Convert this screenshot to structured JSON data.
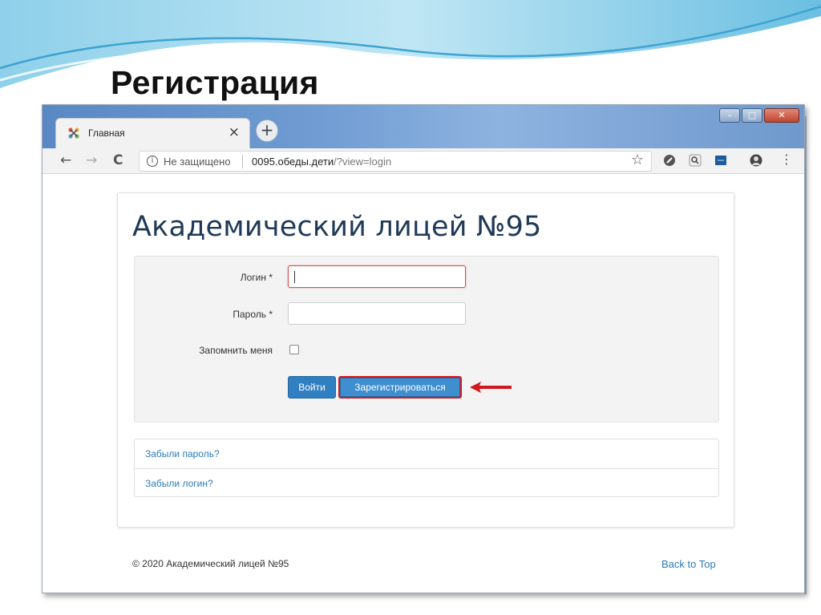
{
  "slide": {
    "title": "Регистрация"
  },
  "browser": {
    "tab_title": "Главная",
    "tab_close": "×",
    "new_tab": "+",
    "nav_back": "←",
    "nav_forward": "→",
    "nav_reload": "C",
    "security_label": "Не защищено",
    "url_domain": "0095.обеды.дети",
    "url_path": "/?view=login",
    "bookmark_star": "☆",
    "menu_dots": "⋮",
    "window_minimize": "–",
    "window_maximize": "□",
    "window_close": "✕"
  },
  "page": {
    "site_title": "Академический лицей №95",
    "form": {
      "login_label": "Логин *",
      "login_value": "",
      "password_label": "Пароль *",
      "password_value": "",
      "remember_label": "Запомнить меня",
      "remember_checked": false,
      "login_button": "Войти",
      "register_button": "Зарегистрироваться"
    },
    "links": {
      "forgot_password": "Забыли пароль?",
      "forgot_login": "Забыли логин?"
    },
    "footer": {
      "copyright": "© 2020 Академический лицей №95",
      "back_to_top": "Back to Top"
    }
  },
  "colors": {
    "accent": "#2f7fc1",
    "highlight": "#d0191f",
    "link": "#2b7bb5"
  }
}
